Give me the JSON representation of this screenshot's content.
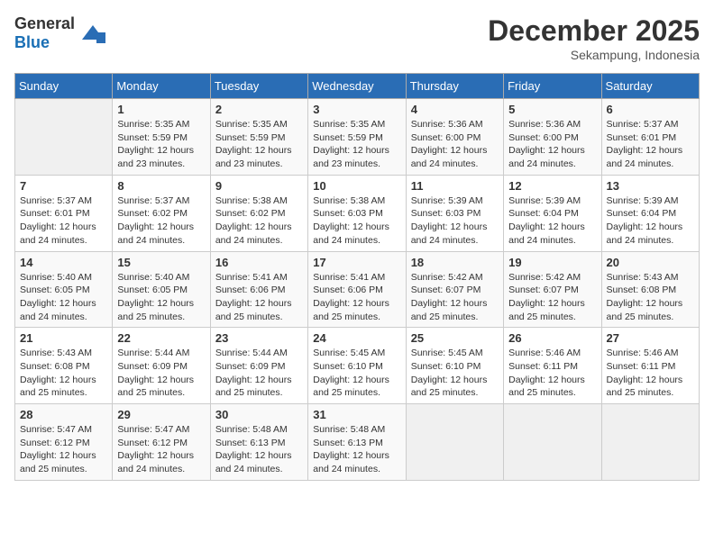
{
  "logo": {
    "general": "General",
    "blue": "Blue"
  },
  "title": "December 2025",
  "location": "Sekampung, Indonesia",
  "days_header": [
    "Sunday",
    "Monday",
    "Tuesday",
    "Wednesday",
    "Thursday",
    "Friday",
    "Saturday"
  ],
  "weeks": [
    [
      {
        "day": "",
        "info": ""
      },
      {
        "day": "1",
        "info": "Sunrise: 5:35 AM\nSunset: 5:59 PM\nDaylight: 12 hours\nand 23 minutes."
      },
      {
        "day": "2",
        "info": "Sunrise: 5:35 AM\nSunset: 5:59 PM\nDaylight: 12 hours\nand 23 minutes."
      },
      {
        "day": "3",
        "info": "Sunrise: 5:35 AM\nSunset: 5:59 PM\nDaylight: 12 hours\nand 23 minutes."
      },
      {
        "day": "4",
        "info": "Sunrise: 5:36 AM\nSunset: 6:00 PM\nDaylight: 12 hours\nand 24 minutes."
      },
      {
        "day": "5",
        "info": "Sunrise: 5:36 AM\nSunset: 6:00 PM\nDaylight: 12 hours\nand 24 minutes."
      },
      {
        "day": "6",
        "info": "Sunrise: 5:37 AM\nSunset: 6:01 PM\nDaylight: 12 hours\nand 24 minutes."
      }
    ],
    [
      {
        "day": "7",
        "info": "Sunrise: 5:37 AM\nSunset: 6:01 PM\nDaylight: 12 hours\nand 24 minutes."
      },
      {
        "day": "8",
        "info": "Sunrise: 5:37 AM\nSunset: 6:02 PM\nDaylight: 12 hours\nand 24 minutes."
      },
      {
        "day": "9",
        "info": "Sunrise: 5:38 AM\nSunset: 6:02 PM\nDaylight: 12 hours\nand 24 minutes."
      },
      {
        "day": "10",
        "info": "Sunrise: 5:38 AM\nSunset: 6:03 PM\nDaylight: 12 hours\nand 24 minutes."
      },
      {
        "day": "11",
        "info": "Sunrise: 5:39 AM\nSunset: 6:03 PM\nDaylight: 12 hours\nand 24 minutes."
      },
      {
        "day": "12",
        "info": "Sunrise: 5:39 AM\nSunset: 6:04 PM\nDaylight: 12 hours\nand 24 minutes."
      },
      {
        "day": "13",
        "info": "Sunrise: 5:39 AM\nSunset: 6:04 PM\nDaylight: 12 hours\nand 24 minutes."
      }
    ],
    [
      {
        "day": "14",
        "info": "Sunrise: 5:40 AM\nSunset: 6:05 PM\nDaylight: 12 hours\nand 24 minutes."
      },
      {
        "day": "15",
        "info": "Sunrise: 5:40 AM\nSunset: 6:05 PM\nDaylight: 12 hours\nand 25 minutes."
      },
      {
        "day": "16",
        "info": "Sunrise: 5:41 AM\nSunset: 6:06 PM\nDaylight: 12 hours\nand 25 minutes."
      },
      {
        "day": "17",
        "info": "Sunrise: 5:41 AM\nSunset: 6:06 PM\nDaylight: 12 hours\nand 25 minutes."
      },
      {
        "day": "18",
        "info": "Sunrise: 5:42 AM\nSunset: 6:07 PM\nDaylight: 12 hours\nand 25 minutes."
      },
      {
        "day": "19",
        "info": "Sunrise: 5:42 AM\nSunset: 6:07 PM\nDaylight: 12 hours\nand 25 minutes."
      },
      {
        "day": "20",
        "info": "Sunrise: 5:43 AM\nSunset: 6:08 PM\nDaylight: 12 hours\nand 25 minutes."
      }
    ],
    [
      {
        "day": "21",
        "info": "Sunrise: 5:43 AM\nSunset: 6:08 PM\nDaylight: 12 hours\nand 25 minutes."
      },
      {
        "day": "22",
        "info": "Sunrise: 5:44 AM\nSunset: 6:09 PM\nDaylight: 12 hours\nand 25 minutes."
      },
      {
        "day": "23",
        "info": "Sunrise: 5:44 AM\nSunset: 6:09 PM\nDaylight: 12 hours\nand 25 minutes."
      },
      {
        "day": "24",
        "info": "Sunrise: 5:45 AM\nSunset: 6:10 PM\nDaylight: 12 hours\nand 25 minutes."
      },
      {
        "day": "25",
        "info": "Sunrise: 5:45 AM\nSunset: 6:10 PM\nDaylight: 12 hours\nand 25 minutes."
      },
      {
        "day": "26",
        "info": "Sunrise: 5:46 AM\nSunset: 6:11 PM\nDaylight: 12 hours\nand 25 minutes."
      },
      {
        "day": "27",
        "info": "Sunrise: 5:46 AM\nSunset: 6:11 PM\nDaylight: 12 hours\nand 25 minutes."
      }
    ],
    [
      {
        "day": "28",
        "info": "Sunrise: 5:47 AM\nSunset: 6:12 PM\nDaylight: 12 hours\nand 25 minutes."
      },
      {
        "day": "29",
        "info": "Sunrise: 5:47 AM\nSunset: 6:12 PM\nDaylight: 12 hours\nand 24 minutes."
      },
      {
        "day": "30",
        "info": "Sunrise: 5:48 AM\nSunset: 6:13 PM\nDaylight: 12 hours\nand 24 minutes."
      },
      {
        "day": "31",
        "info": "Sunrise: 5:48 AM\nSunset: 6:13 PM\nDaylight: 12 hours\nand 24 minutes."
      },
      {
        "day": "",
        "info": ""
      },
      {
        "day": "",
        "info": ""
      },
      {
        "day": "",
        "info": ""
      }
    ]
  ]
}
